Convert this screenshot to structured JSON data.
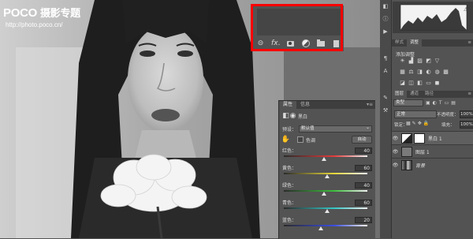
{
  "watermark": {
    "brand": "POCO",
    "brand_cn": "摄影专题",
    "url": "http://photo.poco.cn/"
  },
  "mini_panel": {
    "icons": [
      "link-icon",
      "fx-icon",
      "add-mask-icon",
      "adjustment-layer-icon",
      "new-group-icon",
      "new-layer-icon"
    ],
    "fx_label": "fx",
    "highlight_color": "#ff0000"
  },
  "properties": {
    "tabs": [
      "属性",
      "信息"
    ],
    "menu": "▾≡",
    "adjustment_name": "黑白",
    "preset_label": "预设：",
    "preset_value": "默认值",
    "tint_label": "色调",
    "auto_label": "自动",
    "sliders": [
      {
        "label": "红色：",
        "value": 40,
        "color": "#e43b3b"
      },
      {
        "label": "黄色：",
        "value": 60,
        "color": "#e6d63a"
      },
      {
        "label": "绿色：",
        "value": 40,
        "color": "#3bbf3b"
      },
      {
        "label": "青色：",
        "value": 60,
        "color": "#35c5c5"
      },
      {
        "label": "蓝色：",
        "value": 20,
        "color": "#3a4de0"
      }
    ]
  },
  "dock": {
    "adjust_tabs": [
      "样式",
      "调整"
    ],
    "add_adjustment": "添加调整",
    "layer_tabs": [
      "图层",
      "通道",
      "路径"
    ],
    "kind": "类型",
    "blend_mode": "正常",
    "opacity_label": "不透明度：",
    "opacity": "100%",
    "lock_label": "锁定：",
    "fill_label": "填充：",
    "fill": "100%",
    "layers": [
      {
        "name": "黑白 1",
        "selected": true,
        "italic": false,
        "thumb": "adjustment"
      },
      {
        "name": "图层 1",
        "selected": false,
        "italic": false,
        "thumb": "gray"
      },
      {
        "name": "背景",
        "selected": false,
        "italic": true,
        "thumb": "photo"
      }
    ]
  }
}
